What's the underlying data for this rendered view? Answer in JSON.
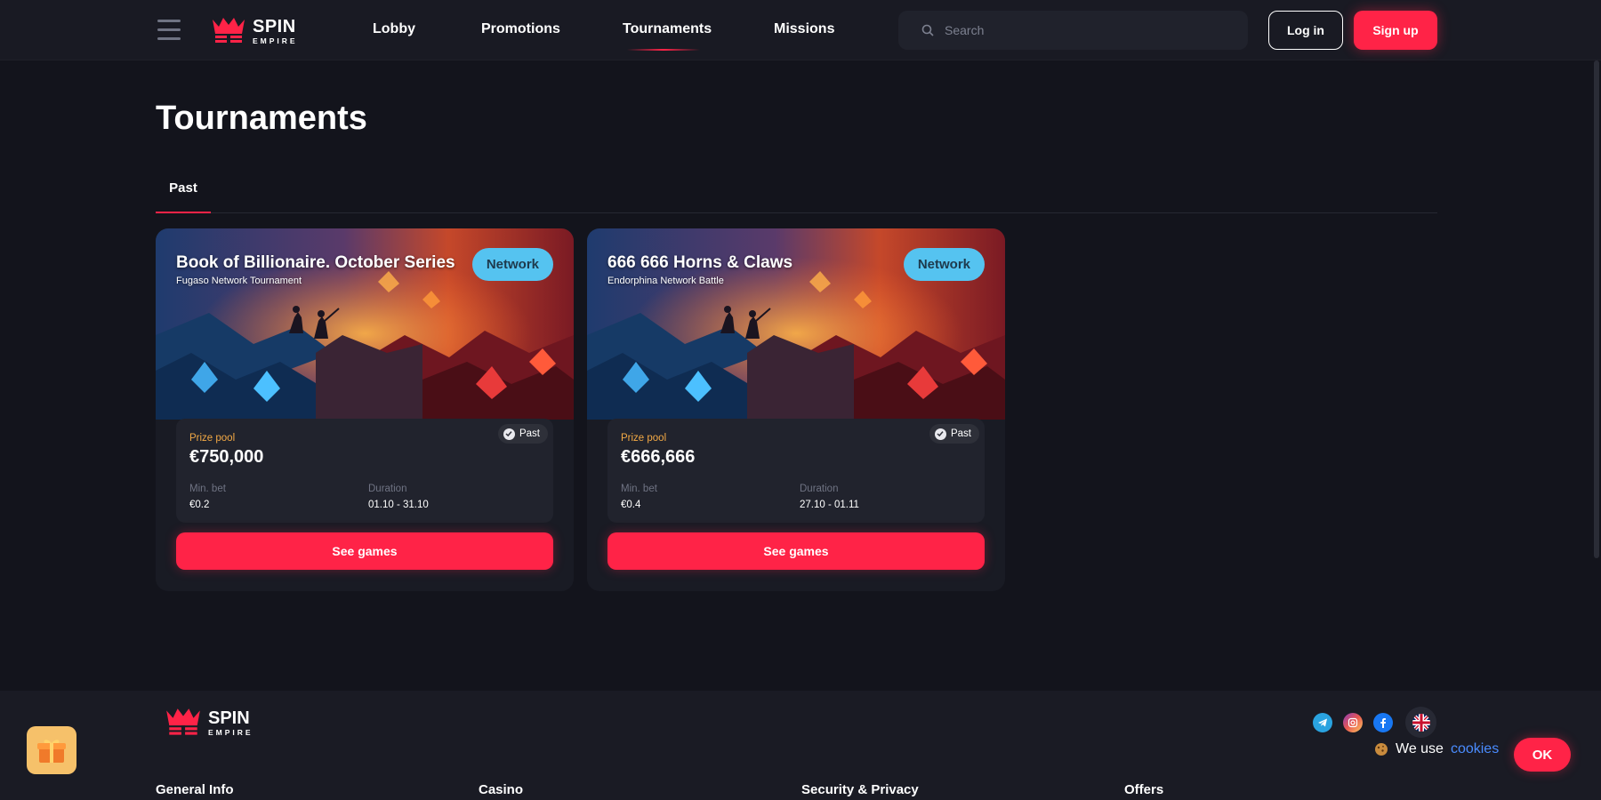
{
  "brand": {
    "line1": "SPIN",
    "line2": "EMPIRE",
    "accent": "#ff2347"
  },
  "nav": {
    "items": [
      {
        "label": "Lobby"
      },
      {
        "label": "Promotions"
      },
      {
        "label": "Tournaments",
        "active": true
      },
      {
        "label": "Missions"
      }
    ]
  },
  "search": {
    "placeholder": "Search",
    "icon": "search-icon"
  },
  "auth": {
    "login_label": "Log in",
    "signup_label": "Sign up"
  },
  "page": {
    "title": "Tournaments"
  },
  "tabs": [
    {
      "label": "Past",
      "active": true
    }
  ],
  "tournaments": [
    {
      "title": "Book of Billionaire. October Series",
      "subtitle": "Fugaso Network Tournament",
      "badge": "Network",
      "status": "Past",
      "prize_label": "Prize pool",
      "prize_value": "€750,000",
      "min_bet_label": "Min. bet",
      "min_bet_value": "€0.2",
      "duration_label": "Duration",
      "duration_value": "01.10 - 31.10",
      "button_label": "See games"
    },
    {
      "title": "666 666 Horns & Claws",
      "subtitle": "Endorphina Network Battle",
      "badge": "Network",
      "status": "Past",
      "prize_label": "Prize pool",
      "prize_value": "€666,666",
      "min_bet_label": "Min. bet",
      "min_bet_value": "€0.4",
      "duration_label": "Duration",
      "duration_value": "27.10 - 01.11",
      "button_label": "See games"
    }
  ],
  "footer": {
    "columns": [
      "General Info",
      "Casino",
      "Security & Privacy",
      "Offers"
    ],
    "social": [
      "telegram-icon",
      "instagram-icon",
      "facebook-icon"
    ],
    "language": "uk-flag-icon"
  },
  "cookie": {
    "text": "We use",
    "link": "cookies",
    "ok_label": "OK"
  }
}
